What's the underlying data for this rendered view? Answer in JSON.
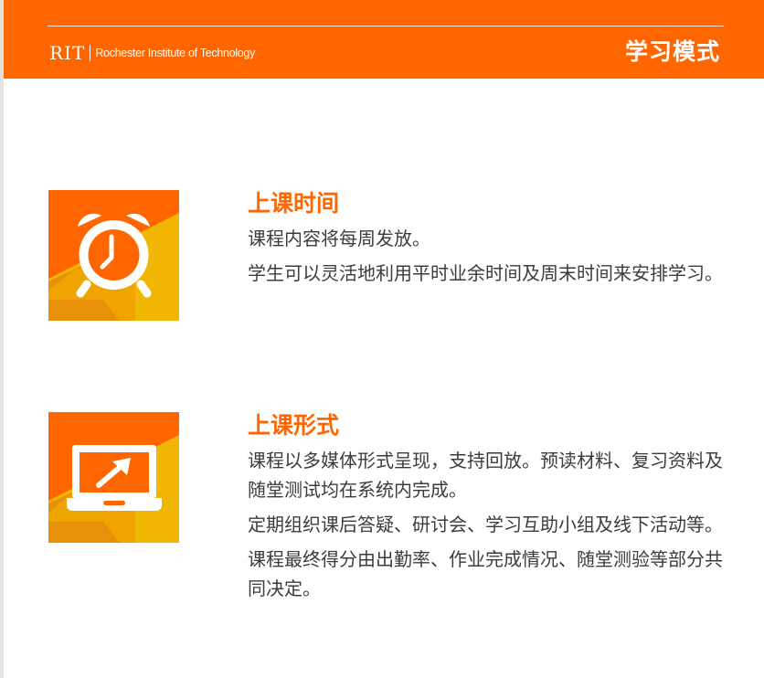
{
  "header": {
    "logo_mark": "RIT",
    "logo_text": "Rochester Institute of Technology",
    "title": "学习模式"
  },
  "sections": [
    {
      "icon": "alarm-clock-icon",
      "title": "上课时间",
      "paragraphs": [
        "课程内容将每周发放。",
        "学生可以灵活地利用平时业余时间及周末时间来安排学习。"
      ]
    },
    {
      "icon": "laptop-icon",
      "title": "上课形式",
      "paragraphs": [
        "课程以多媒体形式呈现，支持回放。预读材料、复习资料及随堂测试均在系统内完成。",
        "定期组织课后答疑、研讨会、学习互助小组及线下活动等。",
        "课程最终得分由出勤率、作业完成情况、随堂测验等部分共同决定。"
      ]
    }
  ],
  "colors": {
    "brand_orange": "#ff6600",
    "icon_yellow": "#f2b705",
    "icon_amber": "#e8900a",
    "text": "#3c3c3c"
  }
}
